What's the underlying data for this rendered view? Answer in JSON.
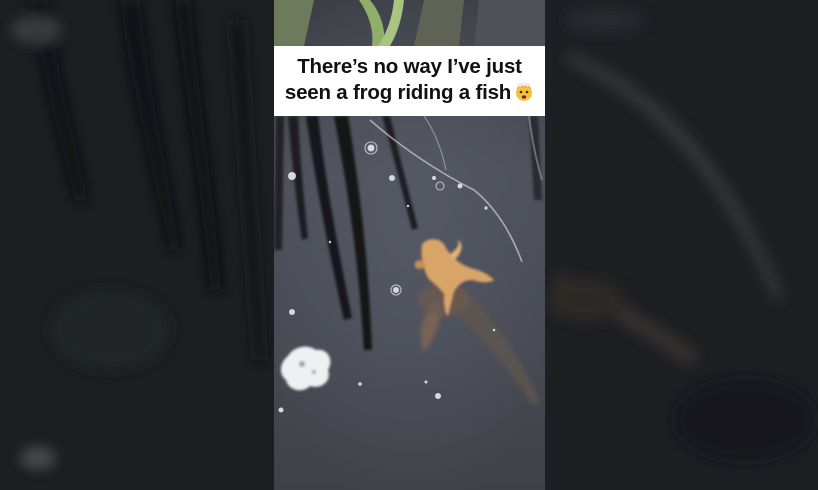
{
  "video": {
    "caption_line_1": "There’s no way I’ve just",
    "caption_line_2": "seen a frog riding a fish",
    "caption_emoji": "exploding-head-emoji",
    "caption_background": "#ffffff",
    "caption_text_color": "#111111"
  },
  "colors": {
    "water": "#4a4c55",
    "frog": "#d9a467",
    "fish": "#5e5550",
    "backdrop": "#1b1d1f"
  }
}
